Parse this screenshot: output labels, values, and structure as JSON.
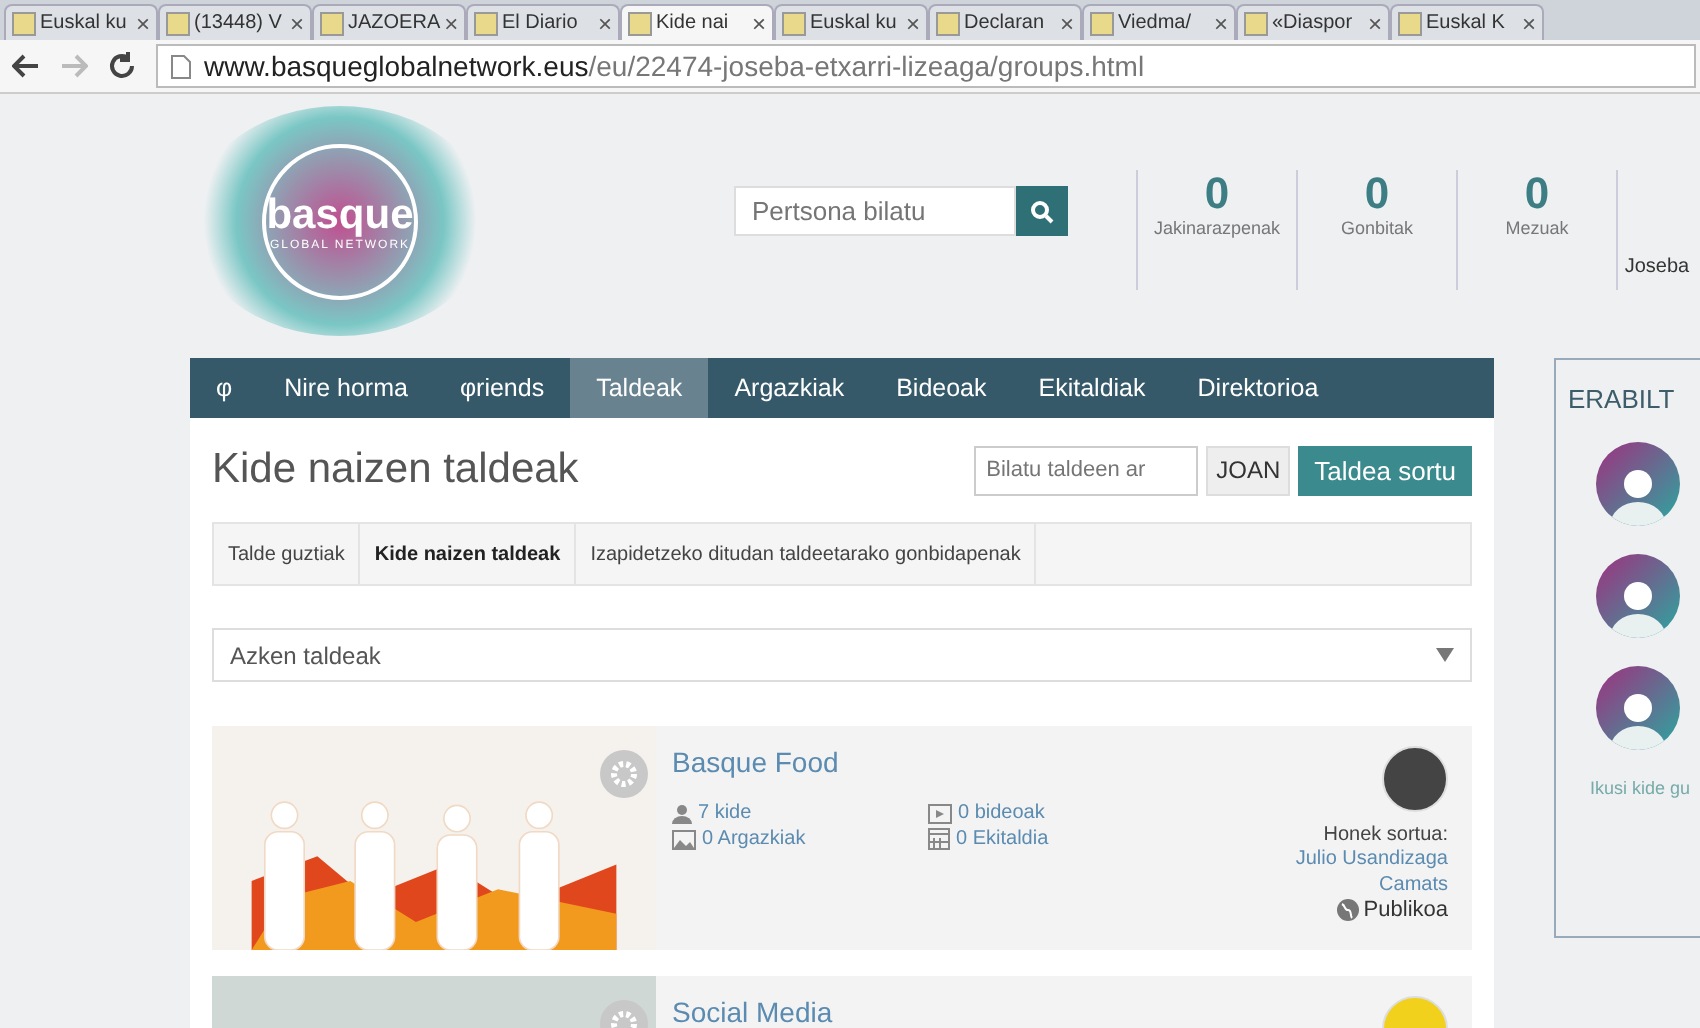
{
  "browser": {
    "tabs": [
      {
        "label": "Euskal ku",
        "selected": false
      },
      {
        "label": "(13448) V",
        "selected": false
      },
      {
        "label": "JAZOERA",
        "selected": false
      },
      {
        "label": "El Diario",
        "selected": false
      },
      {
        "label": "Kide nai",
        "selected": true
      },
      {
        "label": "Euskal ku",
        "selected": false
      },
      {
        "label": "Declaran",
        "selected": false
      },
      {
        "label": "Viedma/",
        "selected": false
      },
      {
        "label": "«Diaspor",
        "selected": false
      },
      {
        "label": "Euskal K",
        "selected": false
      }
    ],
    "close_glyph": "×",
    "url_host": "www.basqueglobalnetwork.eus",
    "url_path": "/eu/22474-joseba-etxarri-lizeaga/groups.html"
  },
  "logo": {
    "word": "basque",
    "tagline": "GLOBAL NETWORK"
  },
  "search": {
    "placeholder": "Pertsona bilatu"
  },
  "counters": [
    {
      "value": "0",
      "label": "Jakinarazpenak"
    },
    {
      "value": "0",
      "label": "Gonbitak"
    },
    {
      "value": "0",
      "label": "Mezuak"
    }
  ],
  "user_name": "Joseba",
  "nav": [
    {
      "label": "φ",
      "selected": false
    },
    {
      "label": "Nire horma",
      "selected": false
    },
    {
      "label": "φriends",
      "selected": false
    },
    {
      "label": "Taldeak",
      "selected": true
    },
    {
      "label": "Argazkiak",
      "selected": false
    },
    {
      "label": "Bideoak",
      "selected": false
    },
    {
      "label": "Ekitaldiak",
      "selected": false
    },
    {
      "label": "Direktorioa",
      "selected": false
    }
  ],
  "page_title": "Kide naizen taldeak",
  "group_search": {
    "placeholder": "Bilatu taldeen ar"
  },
  "go_button": "JOAN",
  "create_button": "Taldea sortu",
  "filters": [
    {
      "label": "Talde guztiak",
      "selected": false
    },
    {
      "label": "Kide naizen taldeak",
      "selected": true
    },
    {
      "label": "Izapidetzeko ditudan taldeetarako gonbidapenak",
      "selected": false
    }
  ],
  "sort": {
    "value": "Azken taldeak"
  },
  "groups": [
    {
      "name": "Basque Food",
      "members": "7 kide",
      "videos": "0 bideoak",
      "photos": "0 Argazkiak",
      "events": "0 Ekitaldia",
      "created_by_label": "Honek sortua:",
      "creator": "Julio Usandizaga",
      "creator_2": "Camats",
      "privacy": "Publikoa"
    },
    {
      "name": "Social Media"
    }
  ],
  "sidebar": {
    "title": "ERABILT",
    "link": "Ikusi kide gu"
  }
}
